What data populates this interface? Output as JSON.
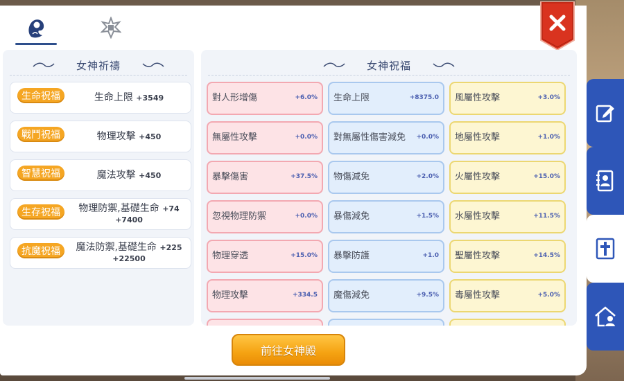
{
  "left_section": {
    "title": "女神祈禱"
  },
  "right_section": {
    "title": "女神祝福"
  },
  "blessings": [
    {
      "badge": "生命祝福",
      "text": "生命上限",
      "value": "+3549",
      "value2": ""
    },
    {
      "badge": "戰鬥祝福",
      "text": "物理攻擊",
      "value": "+450",
      "value2": ""
    },
    {
      "badge": "智慧祝福",
      "text": "魔法攻擊",
      "value": "+450",
      "value2": ""
    },
    {
      "badge": "生存祝福",
      "text": "物理防禦,基礎生命",
      "value": "+74",
      "value2": "+7400"
    },
    {
      "badge": "抗魔祝福",
      "text": "魔法防禦,基礎生命",
      "value": "+225",
      "value2": "+22500"
    }
  ],
  "stats": {
    "pink": [
      {
        "name": "對人形增傷",
        "value": "+6.0%"
      },
      {
        "name": "無屬性攻擊",
        "value": "+0.0%"
      },
      {
        "name": "暴擊傷害",
        "value": "+37.5%"
      },
      {
        "name": "忽視物理防禦",
        "value": "+0.0%"
      },
      {
        "name": "物理穿透",
        "value": "+15.0%"
      },
      {
        "name": "物理攻擊",
        "value": "+334.5"
      }
    ],
    "blue": [
      {
        "name": "生命上限",
        "value": "+8375.0"
      },
      {
        "name": "對無屬性傷害減免",
        "value": "+0.0%"
      },
      {
        "name": "物傷減免",
        "value": "+2.0%"
      },
      {
        "name": "暴傷減免",
        "value": "+1.5%"
      },
      {
        "name": "暴擊防護",
        "value": "+1.0"
      },
      {
        "name": "魔傷減免",
        "value": "+9.5%"
      }
    ],
    "yellow": [
      {
        "name": "風屬性攻擊",
        "value": "+3.0%"
      },
      {
        "name": "地屬性攻擊",
        "value": "+1.0%"
      },
      {
        "name": "火屬性攻擊",
        "value": "+15.0%"
      },
      {
        "name": "水屬性攻擊",
        "value": "+11.5%"
      },
      {
        "name": "聖屬性攻擊",
        "value": "+14.5%"
      },
      {
        "name": "毒屬性攻擊",
        "value": "+5.0%"
      }
    ]
  },
  "go_button": {
    "label": "前往女神殿"
  },
  "colors": {
    "accent_orange": "#f5a623",
    "nav_blue": "#2e56b8",
    "close_red": "#d9331f"
  },
  "icons": {
    "tab1": "goddess-icon",
    "tab2": "emblem-icon",
    "close": "close-icon",
    "side": [
      "edit-icon",
      "contacts-book-icon",
      "cross-shrine-icon",
      "home-user-icon"
    ]
  }
}
